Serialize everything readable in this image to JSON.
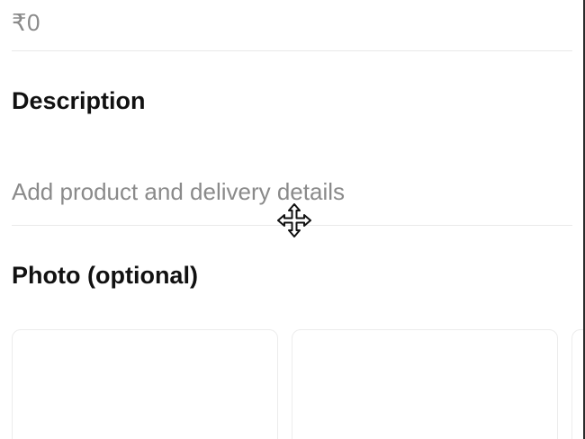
{
  "price": {
    "value": "₹0"
  },
  "description": {
    "title": "Description",
    "placeholder": "Add product and delivery details"
  },
  "photo": {
    "title": "Photo (optional)"
  },
  "cursor": {
    "icon": "move-cursor-icon"
  }
}
